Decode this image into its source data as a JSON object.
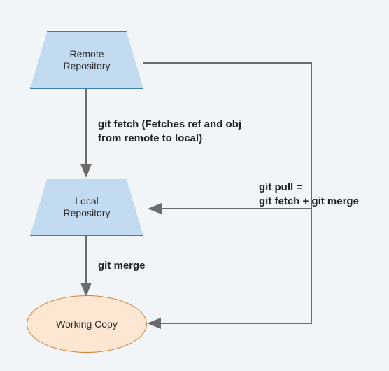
{
  "nodes": {
    "remote": "Remote\nRepository",
    "local": "Local\nRepository",
    "working": "Working Copy"
  },
  "edges": {
    "fetch": "git fetch (Fetches ref and obj\nfrom remote to local)",
    "merge": "git merge",
    "pull": "git pull =\ngit fetch + git merge"
  },
  "chart_data": {
    "type": "diagram",
    "title": "git pull = git fetch + git merge",
    "nodes": [
      {
        "id": "remote",
        "label": "Remote Repository",
        "shape": "trapezoid"
      },
      {
        "id": "local",
        "label": "Local Repository",
        "shape": "trapezoid"
      },
      {
        "id": "working",
        "label": "Working Copy",
        "shape": "ellipse"
      }
    ],
    "edges": [
      {
        "from": "remote",
        "to": "local",
        "label": "git fetch (Fetches ref and obj from remote to local)"
      },
      {
        "from": "local",
        "to": "working",
        "label": "git merge"
      },
      {
        "from": "remote",
        "to": "working",
        "label": "git pull = git fetch + git merge"
      },
      {
        "from": "pull-path",
        "to": "local",
        "label": ""
      }
    ]
  },
  "colors": {
    "trapezoid_fill": "#c3dbf0",
    "trapezoid_stroke": "#3e7cb1",
    "ellipse_fill": "#fde6d2",
    "ellipse_stroke": "#d08038",
    "arrow": "#6b6b6b",
    "background": "#f1f5f8"
  }
}
